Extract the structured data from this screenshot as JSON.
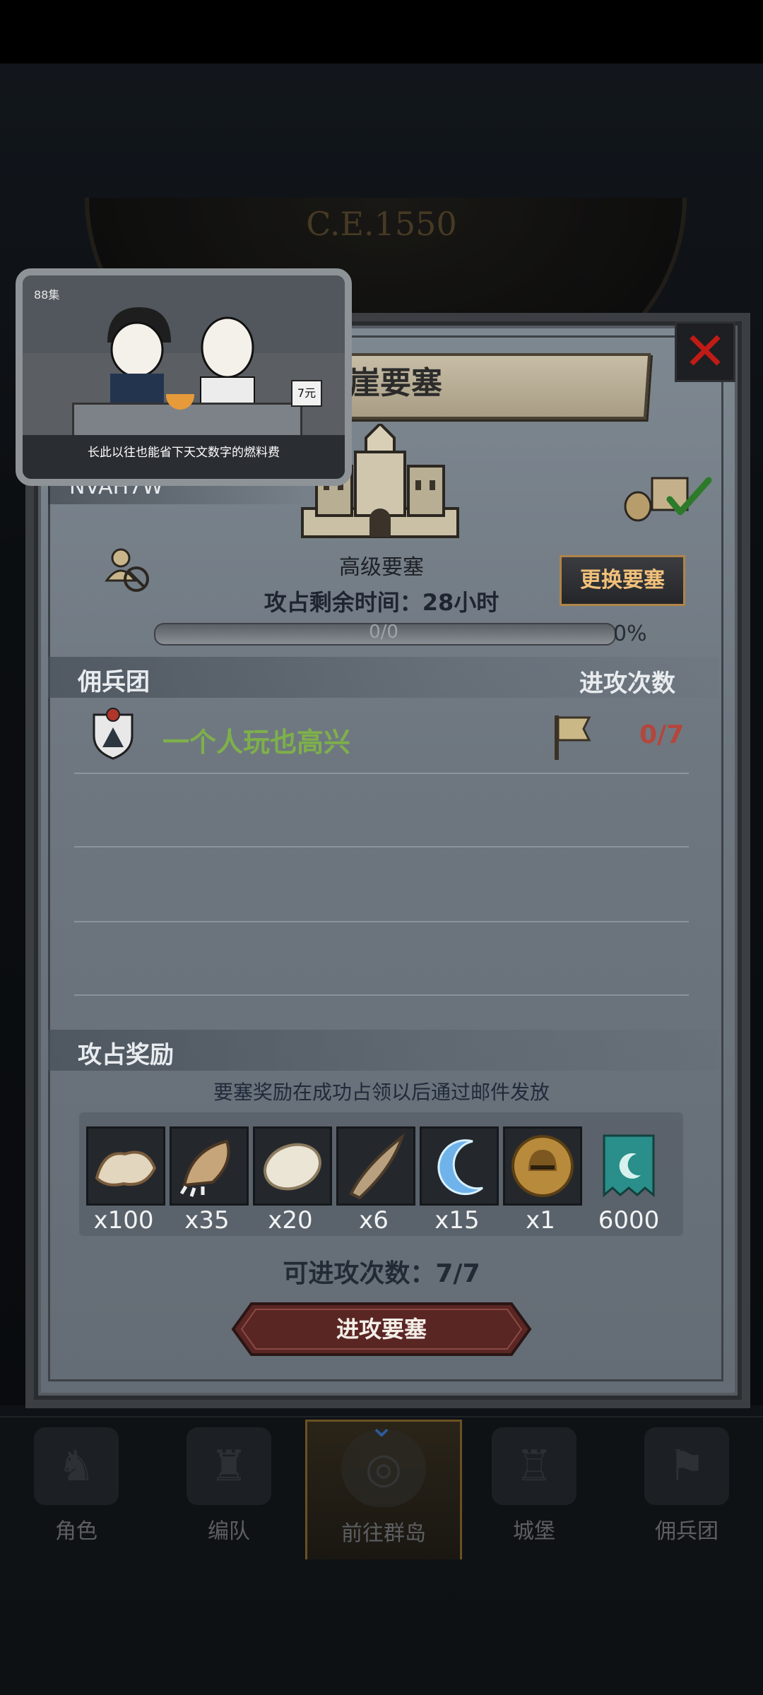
{
  "background": {
    "year_text": "C.E.1550"
  },
  "video_overlay": {
    "episode": "88集",
    "caption": "长此以往也能省下天文数字的燃料费",
    "badge": "7元"
  },
  "panel": {
    "title": "远崖要塞",
    "close_icon": "close-x-icon",
    "fortress_code": "NVAH7W",
    "fortress_name": "高级要塞",
    "swap_button": "更换要塞",
    "remaining_time": "攻占剩余时间：28小时",
    "progress": {
      "text": "0/0",
      "percent_text": "0%",
      "fraction": 0
    },
    "mercenary_section": {
      "title": "佣兵团",
      "attack_header": "进攻次数",
      "rows": [
        {
          "name": "一个人玩也高兴",
          "attacks": "0/7"
        }
      ]
    },
    "reward_section": {
      "title": "攻占奖励",
      "note": "要塞奖励在成功占领以后通过邮件发放",
      "items": [
        {
          "icon": "fur-pelt-icon",
          "qty": "x100"
        },
        {
          "icon": "beast-claw-icon",
          "qty": "x35"
        },
        {
          "icon": "white-fur-icon",
          "qty": "x20"
        },
        {
          "icon": "horn-icon",
          "qty": "x6"
        },
        {
          "icon": "blue-crescent-icon",
          "qty": "x15"
        },
        {
          "icon": "gold-helmet-medal-icon",
          "qty": "x1"
        },
        {
          "icon": "guild-banner-icon",
          "qty": "6000"
        }
      ]
    },
    "attack_count": "可进攻次数：7/7",
    "attack_button": "进攻要塞"
  },
  "bottom_nav": {
    "items": [
      {
        "label": "角色",
        "icon": "knight-icon"
      },
      {
        "label": "编队",
        "icon": "formation-icon"
      },
      {
        "label": "前往群岛",
        "icon": "globe-icon",
        "active": true
      },
      {
        "label": "城堡",
        "icon": "castle-icon"
      },
      {
        "label": "佣兵团",
        "icon": "mercenary-icon"
      }
    ]
  },
  "colors": {
    "accent_gold": "#b08448",
    "guild_green": "#7eb04a",
    "count_red": "#b3463d",
    "close_red": "#c11b16"
  }
}
